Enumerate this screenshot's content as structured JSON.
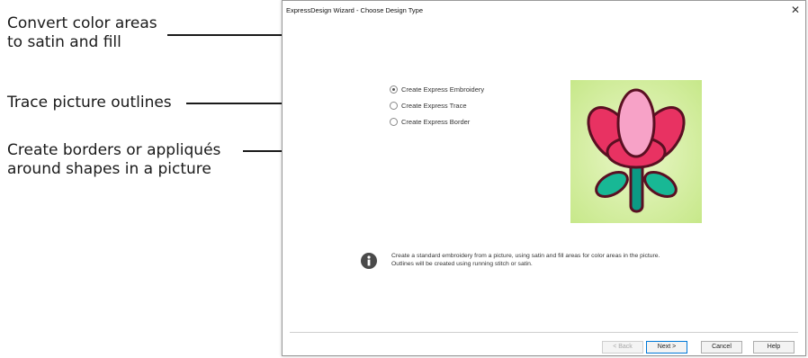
{
  "callouts": [
    {
      "lines": [
        "Convert color areas",
        "to satin and fill"
      ]
    },
    {
      "lines": [
        "Trace picture outlines"
      ]
    },
    {
      "lines": [
        "Create borders or appliqués",
        "around shapes in a picture"
      ]
    }
  ],
  "dialog": {
    "title": "ExpressDesign Wizard - Choose Design Type",
    "close_glyph": "✕",
    "options": [
      {
        "label": "Create Express Embroidery",
        "selected": true
      },
      {
        "label": "Create Express Trace",
        "selected": false
      },
      {
        "label": "Create Express Border",
        "selected": false
      }
    ],
    "preview_icon": "tulip-embroidery-preview",
    "info_icon": "info-icon",
    "description": [
      "Create a standard embroidery from a picture, using satin and fill areas for color areas in the picture.",
      "Outlines will be created using running stitch or satin."
    ],
    "buttons": {
      "back": "< Back",
      "next": "Next >",
      "cancel": "Cancel",
      "help": "Help"
    }
  }
}
